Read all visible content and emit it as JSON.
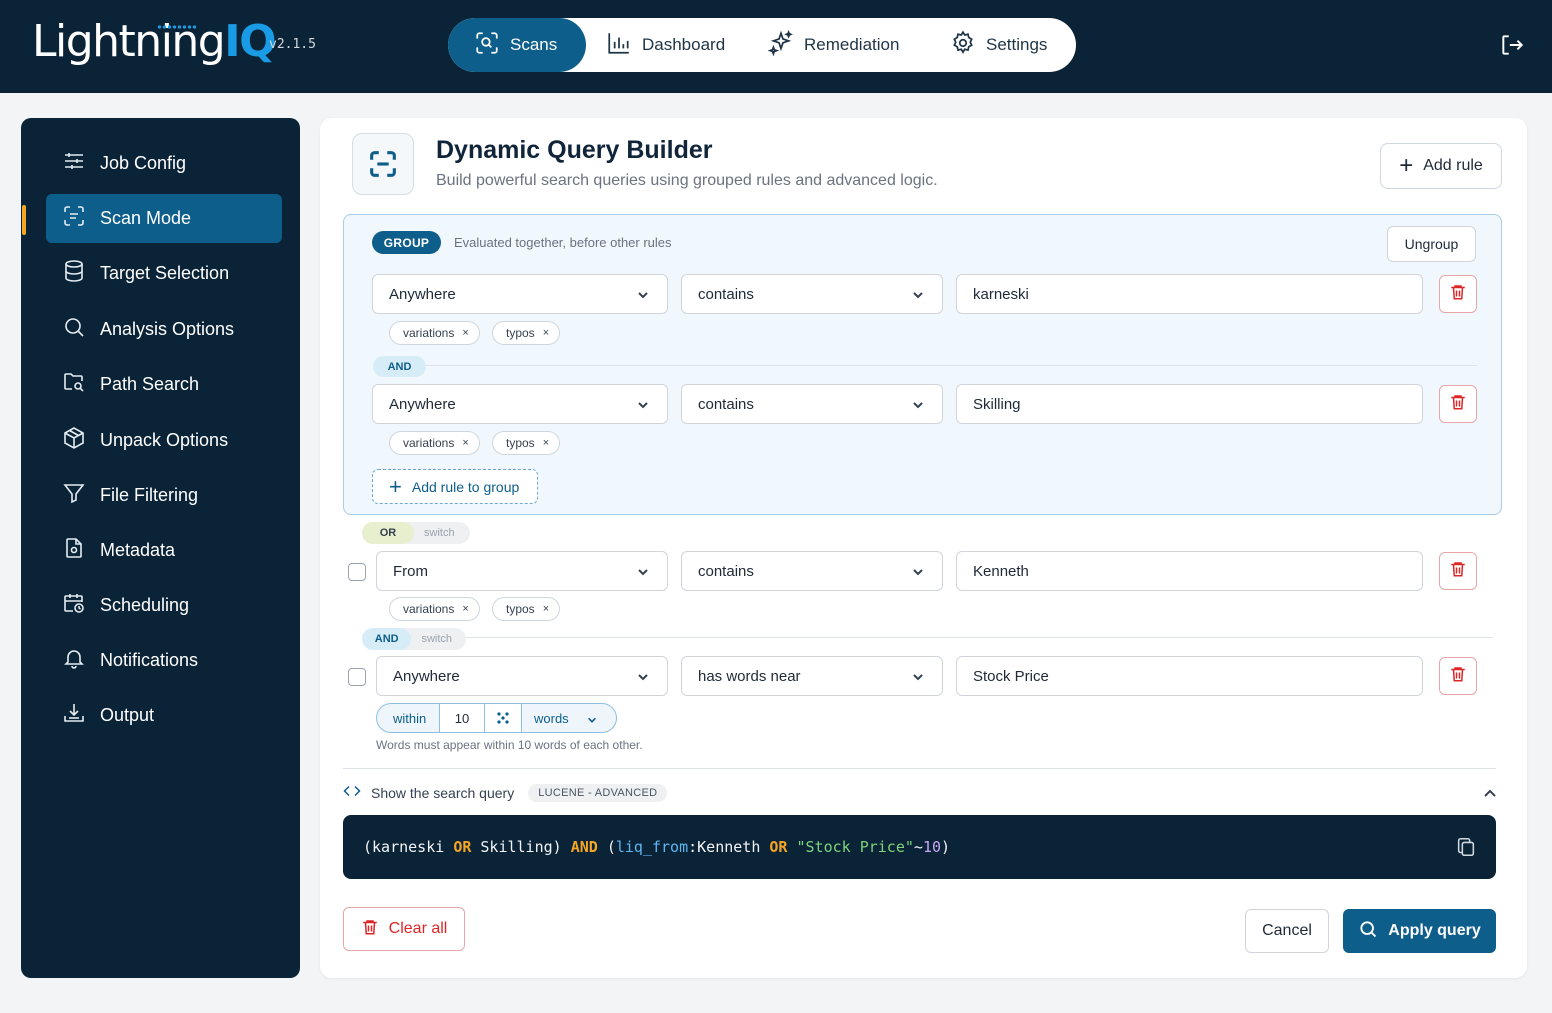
{
  "app": {
    "logo_main": "Lightning",
    "logo_accent": "IQ",
    "version": "v2.1.5"
  },
  "topnav": [
    {
      "label": "Scans",
      "icon": "scan-icon",
      "active": true
    },
    {
      "label": "Dashboard",
      "icon": "bar-chart-icon"
    },
    {
      "label": "Remediation",
      "icon": "sparkles-icon"
    },
    {
      "label": "Settings",
      "icon": "gear-icon"
    }
  ],
  "sidebar": {
    "items": [
      {
        "label": "Job Config",
        "icon": "sliders-icon"
      },
      {
        "label": "Scan Mode",
        "icon": "scan-icon",
        "active": true
      },
      {
        "label": "Target Selection",
        "icon": "database-icon"
      },
      {
        "label": "Analysis Options",
        "icon": "search-icon"
      },
      {
        "label": "Path Search",
        "icon": "folder-search-icon"
      },
      {
        "label": "Unpack Options",
        "icon": "package-icon"
      },
      {
        "label": "File Filtering",
        "icon": "filter-icon"
      },
      {
        "label": "Metadata",
        "icon": "file-meta-icon"
      },
      {
        "label": "Scheduling",
        "icon": "calendar-clock-icon"
      },
      {
        "label": "Notifications",
        "icon": "bell-icon"
      },
      {
        "label": "Output",
        "icon": "download-tray-icon"
      }
    ]
  },
  "builder": {
    "title": "Dynamic Query Builder",
    "subtitle": "Build powerful search queries using grouped rules and advanced logic.",
    "add_rule": "Add rule",
    "group_label": "GROUP",
    "group_note": "Evaluated together, before other rules",
    "ungroup": "Ungroup",
    "add_rule_to_group": "Add rule to group",
    "group_join": "AND",
    "rules": [
      {
        "field": "Anywhere",
        "operator": "contains",
        "value": "karneski",
        "chips": [
          "variations",
          "typos"
        ]
      },
      {
        "field": "Anywhere",
        "operator": "contains",
        "value": "Skilling",
        "chips": [
          "variations",
          "typos"
        ]
      },
      {
        "field": "From",
        "operator": "contains",
        "value": "Kenneth",
        "chips": [
          "variations",
          "typos"
        ]
      },
      {
        "field": "Anywhere",
        "operator": "has words near",
        "value": "Stock Price"
      }
    ],
    "join1": {
      "op": "OR",
      "switch": "switch"
    },
    "join2": {
      "op": "AND",
      "switch": "switch"
    },
    "proximity": {
      "within": "within",
      "distance": "10",
      "unit": "words",
      "hint": "Words must appear within 10 words of each other."
    },
    "show_query": "Show the search query",
    "query_badge": "LUCENE - ADVANCED",
    "query_tokens": [
      {
        "t": "(karneski ",
        "c": ""
      },
      {
        "t": "OR",
        "c": "op"
      },
      {
        "t": " Skilling) ",
        "c": ""
      },
      {
        "t": "AND",
        "c": "op"
      },
      {
        "t": " (",
        "c": ""
      },
      {
        "t": "liq_from",
        "c": "fld"
      },
      {
        "t": ":Kenneth ",
        "c": ""
      },
      {
        "t": "OR",
        "c": "op"
      },
      {
        "t": " ",
        "c": ""
      },
      {
        "t": "\"Stock Price\"",
        "c": "str"
      },
      {
        "t": "~",
        "c": ""
      },
      {
        "t": "10",
        "c": "num"
      },
      {
        "t": ")",
        "c": ""
      }
    ],
    "clear_all": "Clear all",
    "cancel": "Cancel",
    "apply": "Apply query"
  },
  "colors": {
    "navy": "#0b2336",
    "primary": "#0e5e8c",
    "accent": "#f5a623",
    "danger": "#dc2626"
  }
}
